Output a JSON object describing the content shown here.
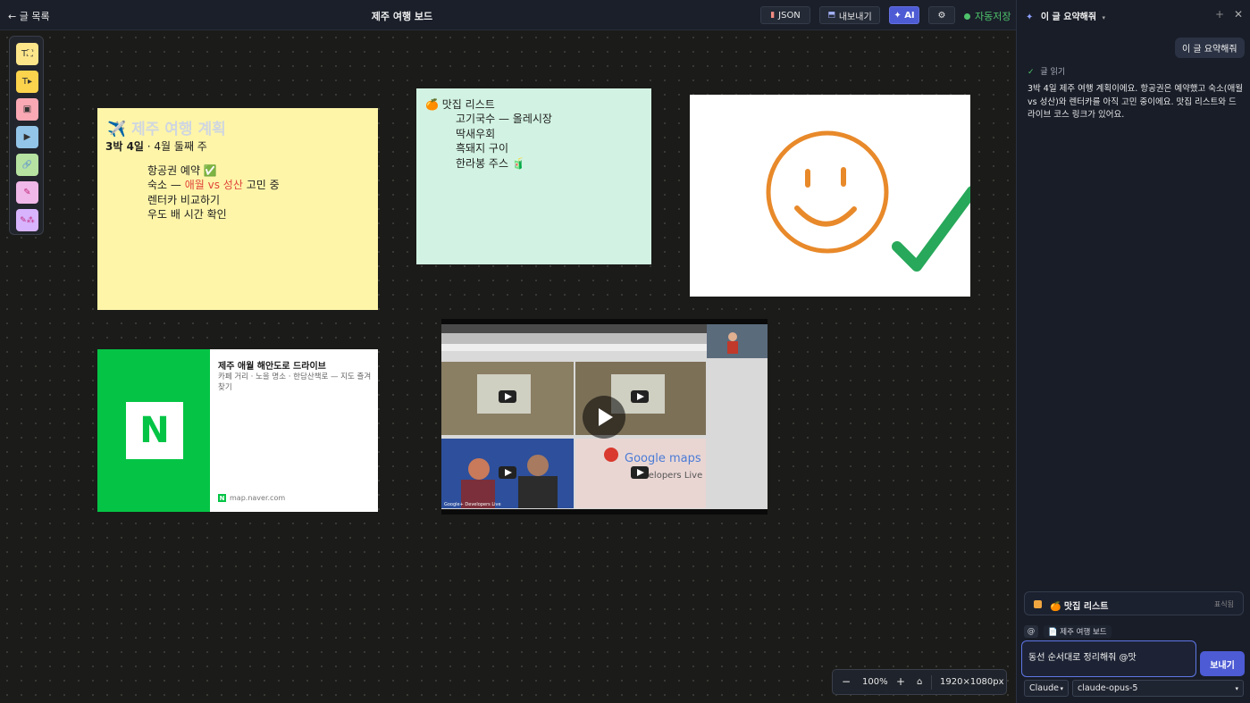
{
  "header": {
    "back_label": "← 글 목록",
    "title": "제주 여행 보드",
    "json_label": "JSON",
    "export_label": "내보내기",
    "ai_label": "✦ AI",
    "settings_icon": "gear-icon",
    "autosave_label": "자동저장"
  },
  "toolbox": {
    "items": [
      {
        "icon": "text-box-icon",
        "glyph": "T⛶",
        "color": "#fde68a"
      },
      {
        "icon": "text-add-icon",
        "glyph": "T▸",
        "color": "#fcd34d"
      },
      {
        "icon": "image-icon",
        "glyph": "▣",
        "color": "#f9a8b4"
      },
      {
        "icon": "video-icon",
        "glyph": "▶",
        "color": "#93c5e8"
      },
      {
        "icon": "link-icon",
        "glyph": "🔗",
        "color": "#b6e3a1"
      },
      {
        "icon": "pen-icon",
        "glyph": "✎",
        "color": "#f0b8e8"
      },
      {
        "icon": "magic-pen-icon",
        "glyph": "✎⁂",
        "color": "#d8b4fe"
      }
    ]
  },
  "notes": {
    "yellow": {
      "title": "✈️ 제주 여행 계획",
      "subtitle_bold": "3박 4일",
      "subtitle_rest": " · 4월 둘째 주",
      "line1": "항공권 예약 ✅",
      "line2_pre": "숙소 — ",
      "line2_red": "애월 vs 성산",
      "line2_post": " 고민 중",
      "line3": "렌터카 비교하기",
      "line4": "우도 배 시간 확인"
    },
    "green": {
      "title": "🍊 맛집 리스트",
      "items": [
        "고기국수 — 올레시장",
        "딱새우회",
        "흑돼지 구이",
        "한라봉 주스 🧃"
      ]
    }
  },
  "link_card": {
    "title": "제주 애월 해안도로 드라이브",
    "description": "카페 거리 · 노을 명소 · 한담산책로 — 지도 즐겨찾기",
    "domain": "map.naver.com",
    "logo_letter": "N"
  },
  "video": {
    "caption_left": "Google+ Developers Live",
    "caption_right": "Google maps",
    "caption_right2": "Developers Live"
  },
  "zoom": {
    "minus": "−",
    "level": "100%",
    "plus": "+",
    "home_icon": "home-icon",
    "canvas_size": "1920×1080px"
  },
  "panel": {
    "title": "이 글 요약해줘",
    "user_message": "이 글 요약해줘",
    "tool_label": "글 읽기",
    "answer": "3박 4일 제주 여행 계획이에요. 항공권은 예약했고 숙소(애월 vs 성산)와 렌터카를 아직 고민 중이에요. 맛집 리스트와 드라이브 코스 링크가 있어요.",
    "context_label": "🍊 맛집 리스트",
    "context_hint": "표식됨",
    "mention_at": "@",
    "mention_chip": "📄 제주 여행 보드",
    "input_value": "동선 순서대로 정리해줘 @맛",
    "send_label": "보내기",
    "provider": "Claude",
    "model": "claude-opus-5"
  }
}
